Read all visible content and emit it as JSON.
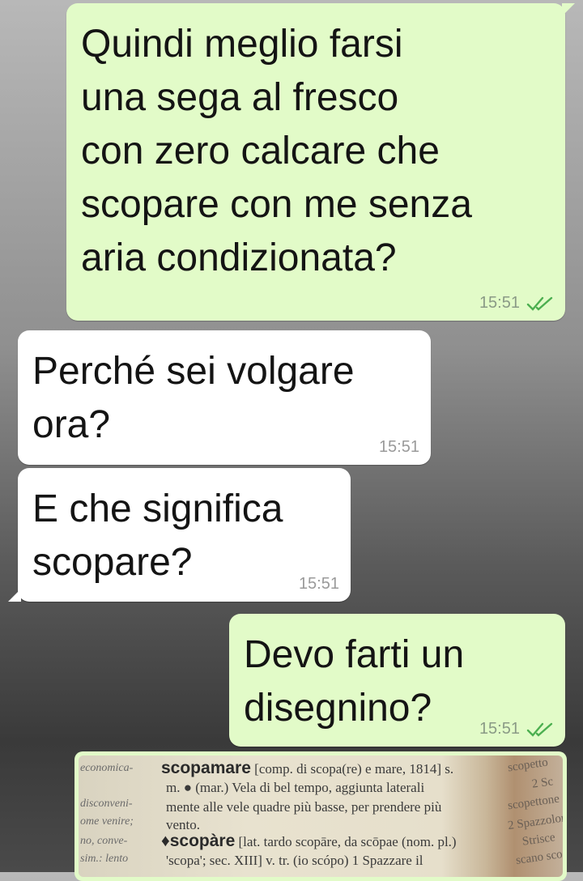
{
  "messages": [
    {
      "id": "m1",
      "direction": "outgoing",
      "text": "Quindi meglio farsi\nuna sega al fresco\ncon zero calcare che\nscopare con me senza\naria condizionata?",
      "time": "15:51",
      "status": "read"
    },
    {
      "id": "m2",
      "direction": "incoming",
      "text": "Perché sei volgare\nora?",
      "time": "15:51"
    },
    {
      "id": "m3",
      "direction": "incoming",
      "text": "E che significa\nscopare?",
      "time": "15:51"
    },
    {
      "id": "m4",
      "direction": "outgoing",
      "text": "Devo farti un\ndisegnino?",
      "time": "15:51",
      "status": "read"
    }
  ],
  "photo_message": {
    "direction": "outgoing",
    "dictionary_text": {
      "left_margin": [
        "economica-",
        "disconveni-",
        "ome venire;",
        "no, conve-",
        "sim.: lento"
      ],
      "lines": [
        {
          "head": "scopamare",
          "rest": "[comp. di scopa(re) e mare, 1814] s."
        },
        {
          "head": "",
          "rest": "m. ● (mar.) Vela di bel tempo, aggiunta laterali"
        },
        {
          "head": "",
          "rest": "mente alle vele quadre più basse, per prendere più"
        },
        {
          "head": "",
          "rest": "vento."
        },
        {
          "head": "♦scopàre",
          "rest": "[lat. tardo scopāre, da scōpae (nom. pl.)"
        },
        {
          "head": "",
          "rest": "'scopa'; sec. XIII] v. tr. (io scópo) 1 Spazzare il"
        }
      ],
      "right_column": [
        "scopetto",
        "2 Sc",
        "scopettone",
        "2 Spazzolon",
        "Strisce",
        "scano sco"
      ]
    }
  },
  "colors": {
    "outgoing_bubble": "#e2fbc8",
    "incoming_bubble": "#ffffff",
    "read_ticks": "#4fc3f7"
  },
  "icons": {
    "read_receipt": "double-check-icon"
  }
}
